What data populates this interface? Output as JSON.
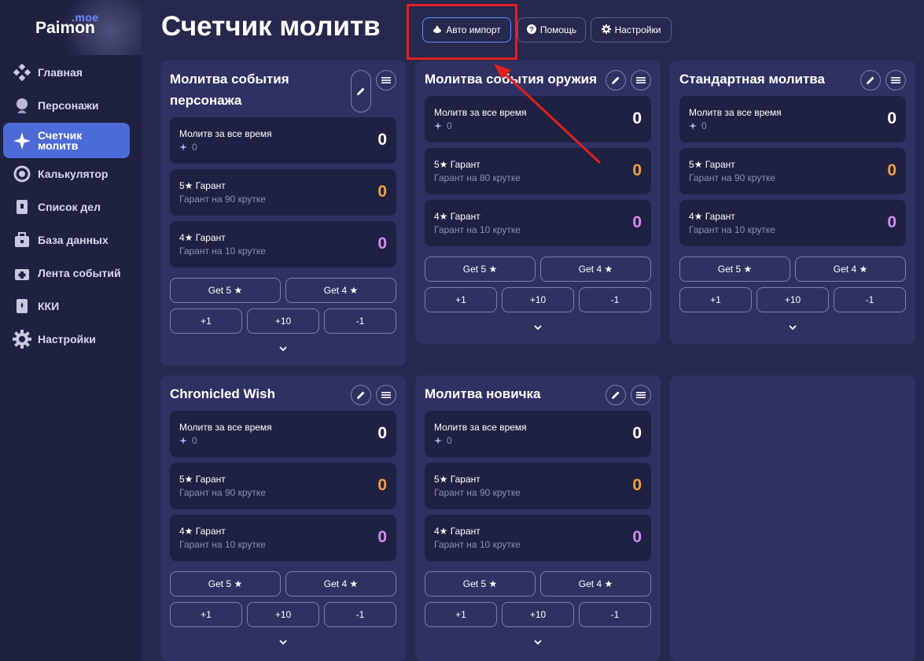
{
  "app": {
    "logo_text": "Paimon",
    "logo_suffix": ".moe"
  },
  "sidebar": {
    "items": [
      {
        "label": "Главная",
        "icon": "home-icon"
      },
      {
        "label": "Персонажи",
        "icon": "character-icon"
      },
      {
        "label": "Счетчик молитв",
        "icon": "sparkle-icon",
        "active": true
      },
      {
        "label": "Калькулятор",
        "icon": "calculator-icon"
      },
      {
        "label": "Список дел",
        "icon": "todo-icon"
      },
      {
        "label": "База данных",
        "icon": "database-icon"
      },
      {
        "label": "Лента событий",
        "icon": "timeline-icon"
      },
      {
        "label": "ККИ",
        "icon": "card-game-icon"
      },
      {
        "label": "Настройки",
        "icon": "gear-icon"
      }
    ]
  },
  "header": {
    "title": "Счетчик молитв",
    "buttons": {
      "auto_import": "Авто импорт",
      "help": "Помощь",
      "settings": "Настройки"
    }
  },
  "common": {
    "total_label": "Молитв за все время",
    "five_label": "5★ Гарант",
    "four_label": "4★ Гарант",
    "four_sub": "Гарант на 10 крутке",
    "get5": "Get 5 ★",
    "get4": "Get 4 ★",
    "plus1": "+1",
    "plus10": "+10",
    "minus1": "-1"
  },
  "cards": [
    {
      "title_line1": "Молитва события",
      "title_line2": "персонажа",
      "total": "0",
      "total_sub": "0",
      "five": "0",
      "five_sub": "Гарант на 90 крутке",
      "four": "0"
    },
    {
      "title_line1": "Молитва события оружия",
      "title_line2": "",
      "total": "0",
      "total_sub": "0",
      "five": "0",
      "five_sub": "Гарант на 80 крутке",
      "four": "0"
    },
    {
      "title_line1": "Стандартная молитва",
      "title_line2": "",
      "total": "0",
      "total_sub": "0",
      "five": "0",
      "five_sub": "Гарант на 90 крутке",
      "four": "0"
    },
    {
      "title_line1": "Chronicled Wish",
      "title_line2": "",
      "total": "0",
      "total_sub": "0",
      "five": "0",
      "five_sub": "Гарант на 90 крутке",
      "four": "0"
    },
    {
      "title_line1": "Молитва новичка",
      "title_line2": "",
      "total": "0",
      "total_sub": "0",
      "five": "0",
      "five_sub": "Гарант на 90 крутке",
      "four": "0"
    }
  ],
  "colors": {
    "accent": "#4d6bd6",
    "five_star": "#f2a03d",
    "four_star": "#d48cf2",
    "highlight_box": "#e11f1f"
  }
}
